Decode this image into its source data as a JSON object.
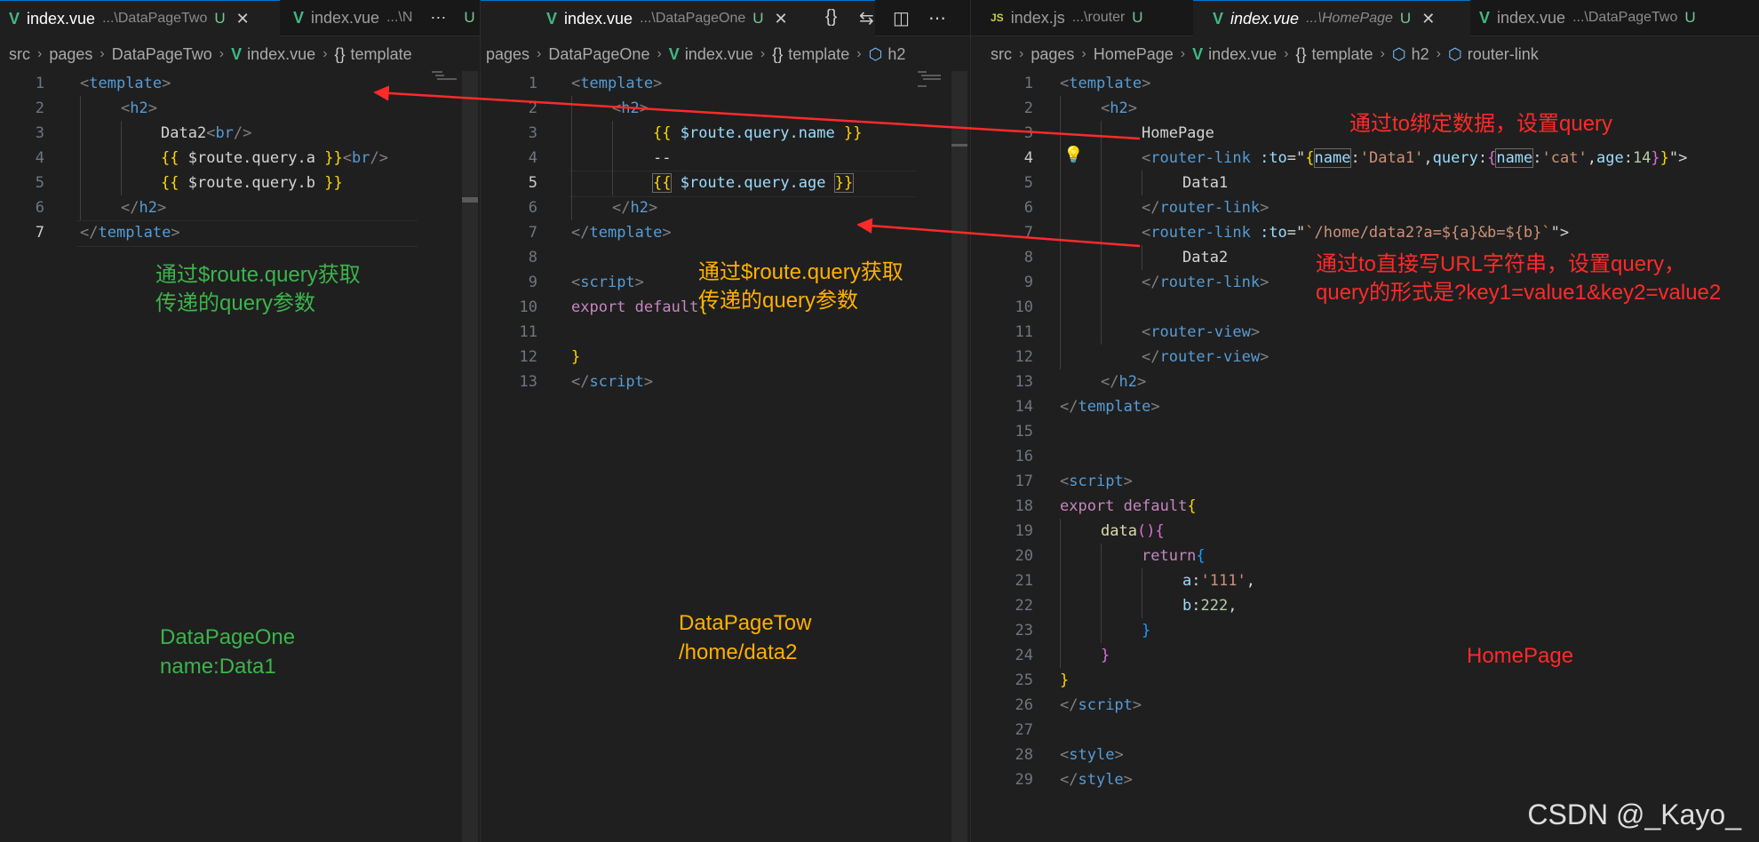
{
  "pane1": {
    "tabs": [
      {
        "name": "index.vue",
        "path": "...\\DataPageTwo",
        "mod": "U",
        "close": "✕"
      },
      {
        "name": "index.vue",
        "path": "...\\N",
        "mod": "U",
        "more": "⋯"
      }
    ],
    "breadcrumb": [
      "src",
      "pages",
      "DataPageTwo",
      "index.vue",
      "template"
    ],
    "lines": [
      "1",
      "2",
      "3",
      "4",
      "5",
      "6",
      "7"
    ],
    "code": {
      "l1a": "<",
      "l1b": "template",
      "l1c": ">",
      "l2a": "<",
      "l2b": "h2",
      "l2c": ">",
      "l3a": "Data2",
      "l3b": "<",
      "l3c": "br",
      "l3d": "/>",
      "l4a": "{{",
      "l4b": " $route.query.a ",
      "l4c": "}}",
      "l4d": "<",
      "l4e": "br",
      "l4f": "/>",
      "l5a": "{{",
      "l5b": " $route.query.b ",
      "l5c": "}}",
      "l6a": "</",
      "l6b": "h2",
      "l6c": ">",
      "l7a": "</",
      "l7b": "template",
      "l7c": ">"
    },
    "annotation_green_1": "通过$route.query获取",
    "annotation_green_2": "传递的query参数",
    "label_1": "DataPageOne",
    "label_2": "name:Data1"
  },
  "pane2": {
    "tabs": [
      {
        "name": "index.vue",
        "path": "...\\DataPageOne",
        "mod": "U",
        "close": "✕"
      }
    ],
    "toolbar": [
      "{}",
      "⇆",
      "◫",
      "⋯"
    ],
    "breadcrumb": [
      "pages",
      "DataPageOne",
      "index.vue",
      "template",
      "h2"
    ],
    "lines": [
      "1",
      "2",
      "3",
      "4",
      "5",
      "6",
      "7",
      "8",
      "9",
      "10",
      "11",
      "12",
      "13"
    ],
    "code": {
      "l1a": "<",
      "l1b": "template",
      "l1c": ">",
      "l2a": "<",
      "l2b": "h2",
      "l2c": ">",
      "l3a": "{{",
      "l3b": " $route.query.name ",
      "l3c": "}}",
      "l4a": "--",
      "l5a": "{{",
      "l5b": " $route",
      "l5c": ".query.age ",
      "l5d": "}}",
      "l6a": "</",
      "l6b": "h2",
      "l6c": ">",
      "l7a": "</",
      "l7b": "template",
      "l7c": ">",
      "l9a": "<",
      "l9b": "script",
      "l9c": ">",
      "l10a": "export",
      "l10b": " default",
      "l10c": "{",
      "l12a": "}",
      "l13a": "</",
      "l13b": "script",
      "l13c": ">"
    },
    "annotation_orange_1": "通过$route.query获取",
    "annotation_orange_2": "传递的query参数",
    "label_1": "DataPageTow",
    "label_2": "/home/data2"
  },
  "pane3": {
    "tabs": [
      {
        "name": "index.js",
        "path": "...\\router",
        "mod": "U"
      },
      {
        "name": "index.vue",
        "path": "...\\HomePage",
        "mod": "U",
        "close": "✕"
      },
      {
        "name": "index.vue",
        "path": "...\\DataPageTwo",
        "mod": "U"
      }
    ],
    "breadcrumb": [
      "src",
      "pages",
      "HomePage",
      "index.vue",
      "template",
      "h2",
      "router-link"
    ],
    "lines": [
      "1",
      "2",
      "3",
      "4",
      "5",
      "6",
      "7",
      "8",
      "9",
      "10",
      "11",
      "12",
      "13",
      "14",
      "15",
      "16",
      "17",
      "18",
      "19",
      "20",
      "21",
      "22",
      "23",
      "24",
      "25",
      "26",
      "27",
      "28",
      "29"
    ],
    "code": {
      "l1a": "<",
      "l1b": "template",
      "l1c": ">",
      "l2a": "<",
      "l2b": "h2",
      "l2c": ">",
      "l3a": "HomePage",
      "l4a": "<",
      "l4b": "router-link",
      "l4c": " :to",
      "l4d": "=\"",
      "l4e": "{",
      "l4f": "name",
      "l4g": ":",
      "l4h": "'Data1'",
      "l4i": ",",
      "l4j": "query",
      "l4k": ":",
      "l4l": "{",
      "l4m": "name",
      "l4n": ":",
      "l4o": "'cat'",
      "l4p": ",",
      "l4q": "age",
      "l4r": ":",
      "l4s": "14",
      "l4t": "}",
      "l4u": "}",
      "l4v": "\">",
      "l5a": "Data1",
      "l6a": "</",
      "l6b": "router-link",
      "l6c": ">",
      "l7a": "<",
      "l7b": "router-link",
      "l7c": " :to",
      "l7d": "=\"",
      "l7e": "`/home/data2?a=${a}&b=${b}`",
      "l7f": "\">",
      "l8a": "Data2",
      "l9a": "</",
      "l9b": "router-link",
      "l9c": ">",
      "l11a": "<",
      "l11b": "router-view",
      "l11c": ">",
      "l12a": "</",
      "l12b": "router-view",
      "l12c": ">",
      "l13a": "</",
      "l13b": "h2",
      "l13c": ">",
      "l14a": "</",
      "l14b": "template",
      "l14c": ">",
      "l17a": "<",
      "l17b": "script",
      "l17c": ">",
      "l18a": "export",
      "l18b": " default",
      "l18c": "{",
      "l19a": "data",
      "l19b": "(){",
      "l20a": "return",
      "l20b": "{",
      "l21a": "a",
      ":l21b": ":",
      "l21c": "'111'",
      "l21d": ",",
      "l22a": "b",
      "l22b": ":",
      "l22c": "222",
      "l22d": ",",
      "l23a": "}",
      "l24a": "}",
      "l25a": "}",
      "l26a": "</",
      "l26b": "script",
      "l26c": ">",
      "l28a": "<",
      "l28b": "style",
      "l28c": ">",
      "l29a": "</",
      "l29b": "style",
      "l29c": ">"
    },
    "annotation_red_1": "通过to绑定数据，设置query",
    "annotation_red_2": "通过to直接写URL字符串，设置query，",
    "annotation_red_3": "query的形式是?key1=value1&key2=value2",
    "label": "HomePage"
  },
  "watermark": "CSDN @_Kayo_",
  "colors": {
    "arrow": "#ff2a2a",
    "green": "#3cb44b",
    "orange": "#ffb000",
    "red": "#ff2a2a",
    "accent": "#0078d4"
  }
}
